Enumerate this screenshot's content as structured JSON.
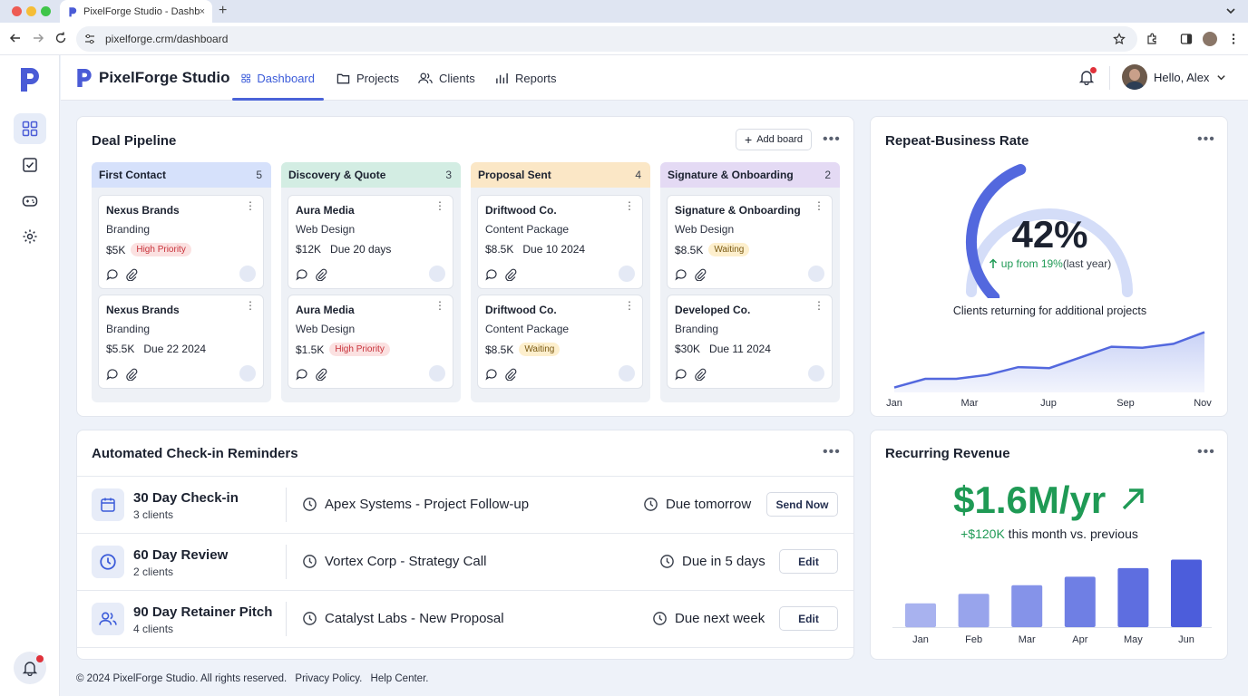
{
  "browser": {
    "tab_title": "PixelForge Studio - Dashboard",
    "tab_close": "×",
    "new_tab": "+",
    "url": "pixelforge.crm/dashboard"
  },
  "app": {
    "brand": "PixelForge Studio",
    "nav": [
      {
        "label": "Dashboard",
        "icon": "grid-icon",
        "active": true
      },
      {
        "label": "Projects",
        "icon": "folder-icon",
        "active": false
      },
      {
        "label": "Clients",
        "icon": "users-icon",
        "active": false
      },
      {
        "label": "Reports",
        "icon": "bar-chart-icon",
        "active": false
      }
    ],
    "greeting": "Hello, Alex"
  },
  "pipeline": {
    "title": "Deal Pipeline",
    "add_board": "Add board",
    "columns": [
      {
        "name": "First Contact",
        "count": "5",
        "color": "#d6e1fb",
        "cards": [
          {
            "company": "Nexus Brands",
            "service": "Branding",
            "value": "$5K",
            "due": "",
            "tag": "High Priority",
            "tag_type": "hp"
          },
          {
            "company": "Nexus Brands",
            "service": "Branding",
            "value": "$5.5K",
            "due": "Due 22 2024",
            "tag": "",
            "tag_type": ""
          }
        ]
      },
      {
        "name": "Discovery & Quote",
        "count": "3",
        "color": "#d3ede3",
        "cards": [
          {
            "company": "Aura Media",
            "service": "Web Design",
            "value": "$12K",
            "due": "Due 20 days",
            "tag": "",
            "tag_type": ""
          },
          {
            "company": "Aura Media",
            "service": "Web Design",
            "value": "$1.5K",
            "due": "",
            "tag": "High Priority",
            "tag_type": "hp"
          }
        ]
      },
      {
        "name": "Proposal Sent",
        "count": "4",
        "color": "#fbe7c6",
        "cards": [
          {
            "company": "Driftwood Co.",
            "service": "Content Package",
            "value": "$8.5K",
            "due": "Due 10 2024",
            "tag": "",
            "tag_type": ""
          },
          {
            "company": "Driftwood Co.",
            "service": "Content Package",
            "value": "$8.5K",
            "due": "",
            "tag": "Waiting",
            "tag_type": "wt"
          }
        ]
      },
      {
        "name": "Signature & Onboarding",
        "count": "2",
        "color": "#e4daf4",
        "cards": [
          {
            "company": "Signature & Onboarding",
            "service": "Web Design",
            "value": "$8.5K",
            "due": "",
            "tag": "Waiting",
            "tag_type": "wt"
          },
          {
            "company": "Developed Co.",
            "service": "Branding",
            "value": "$30K",
            "due": "Due 11 2024",
            "tag": "",
            "tag_type": ""
          }
        ]
      }
    ]
  },
  "repeat": {
    "title": "Repeat-Business Rate",
    "percent": "42%",
    "gauge_value": 0.42,
    "change": "up from 19%",
    "change_suffix": " (last year)",
    "caption": "Clients returning for additional projects",
    "months": [
      "Jan",
      "Mar",
      "Jup",
      "Sep",
      "Nov"
    ]
  },
  "reminders": {
    "title": "Automated Check-in Reminders",
    "items": [
      {
        "name": "30 Day Check-in",
        "clients": "3 clients",
        "icon": "calendar-icon",
        "task": "Apex Systems - Project Follow-up",
        "due": "Due tomorrow",
        "action": "Send Now"
      },
      {
        "name": "60 Day Review",
        "clients": "2 clients",
        "icon": "clock-icon",
        "task": "Vortex Corp - Strategy Call",
        "due": "Due in 5 days",
        "action": "Edit"
      },
      {
        "name": "90 Day Retainer Pitch",
        "clients": "4 clients",
        "icon": "users-icon",
        "task": "Catalyst Labs - New Proposal",
        "due": "Due next week",
        "action": "Edit"
      }
    ]
  },
  "revenue": {
    "title": "Recurring Revenue",
    "amount": "$1.6M/yr",
    "change": "+$120K",
    "change_suffix": " this month vs. previous"
  },
  "footer": {
    "copyright": "© 2024 PixelForge Studio. All rights reserved.",
    "privacy": "Privacy Policy.",
    "help": "Help Center."
  },
  "chart_data": [
    {
      "type": "line",
      "title": "",
      "x": [
        "Jan",
        "Feb",
        "Mar",
        "Apr",
        "May",
        "Jun",
        "Jul",
        "Aug",
        "Sep",
        "Oct",
        "Nov"
      ],
      "series": [
        {
          "values": [
            5,
            14,
            14,
            18,
            26,
            25,
            36,
            47,
            46,
            50,
            62
          ]
        }
      ],
      "xticks": [
        "Jan",
        "Mar",
        "Jup",
        "Sep",
        "Nov"
      ],
      "ylim": [
        0,
        70
      ],
      "grid": false
    },
    {
      "type": "bar",
      "title": "",
      "categories": [
        "Jan",
        "Feb",
        "Mar",
        "Apr",
        "May",
        "Jun"
      ],
      "values": [
        25,
        35,
        44,
        53,
        62,
        71
      ],
      "ylim": [
        0,
        80
      ],
      "colors": [
        "#a8b2ef",
        "#98a4ec",
        "#8593e9",
        "#6f7fe4",
        "#5e6ee0",
        "#4c5ddb"
      ],
      "grid": false
    }
  ]
}
